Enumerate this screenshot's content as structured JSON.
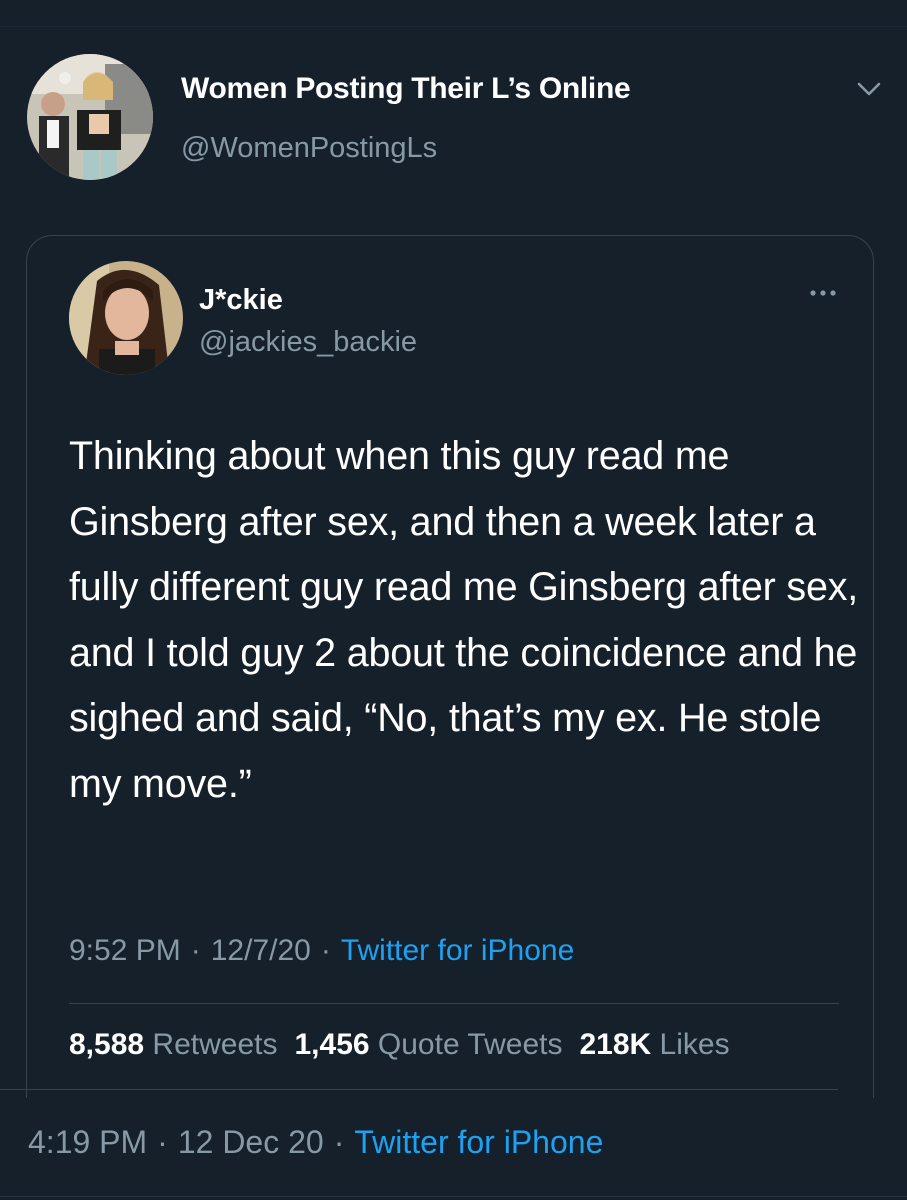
{
  "outer_tweet": {
    "display_name": "Women Posting Their L’s Online",
    "handle": "@WomenPostingLs",
    "time": "4:19 PM",
    "date": "12 Dec 20",
    "separator": "·",
    "source": "Twitter for iPhone",
    "menu_icon": "chevron-down-icon"
  },
  "quoted_tweet": {
    "display_name": "J*ckie",
    "handle": "@jackies_backie",
    "menu_icon": "more-dots-icon",
    "text": "Thinking about when this guy read me Ginsberg after sex, and then a week later a fully different guy read me Ginsberg after sex, and I told guy 2 about the coincidence and he sighed and said, “No, that’s my ex. He stole my move.”",
    "time": "9:52 PM",
    "date": "12/7/20",
    "separator": "·",
    "source": "Twitter for iPhone",
    "stats": {
      "retweets_count": "8,588",
      "retweets_label": "Retweets",
      "quotes_count": "1,456",
      "quotes_label": "Quote Tweets",
      "likes_count": "218K",
      "likes_label": "Likes"
    }
  },
  "colors": {
    "background": "#15202b",
    "text_primary": "#ffffff",
    "text_secondary": "#8899a6",
    "link": "#1da1f2",
    "border": "#38444d"
  }
}
